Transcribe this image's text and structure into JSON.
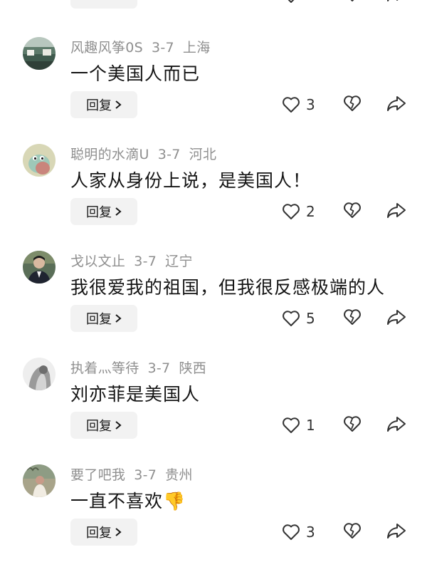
{
  "comments": [
    {
      "user": "风趣风筝0S",
      "date": "3-7",
      "location": "上海",
      "text": "一个美国人而已",
      "likes": "3",
      "reply_label": "回复"
    },
    {
      "user": "聪明的水滴U",
      "date": "3-7",
      "location": "河北",
      "text": "人家从身份上说，是美国人！",
      "likes": "2",
      "reply_label": "回复"
    },
    {
      "user": "戈以文止",
      "date": "3-7",
      "location": "辽宁",
      "text": "我很爱我的祖国，但我很反感极端的人",
      "likes": "5",
      "reply_label": "回复"
    },
    {
      "user": "执着灬等待",
      "date": "3-7",
      "location": "陕西",
      "text": "刘亦菲是美国人",
      "likes": "1",
      "reply_label": "回复"
    },
    {
      "user": "要了吧我",
      "date": "3-7",
      "location": "贵州",
      "text": "一直不喜欢",
      "emoji": "👎",
      "likes": "3",
      "reply_label": "回复"
    }
  ],
  "icons": {
    "like": "heart-icon",
    "dislike": "broken-heart-icon",
    "share": "share-arrow-icon",
    "reply_chevron": "chevron-right-icon"
  },
  "colors": {
    "meta_text": "#8f8f8f",
    "reply_bg": "#f2f2f2",
    "icon_stroke": "#333333"
  }
}
